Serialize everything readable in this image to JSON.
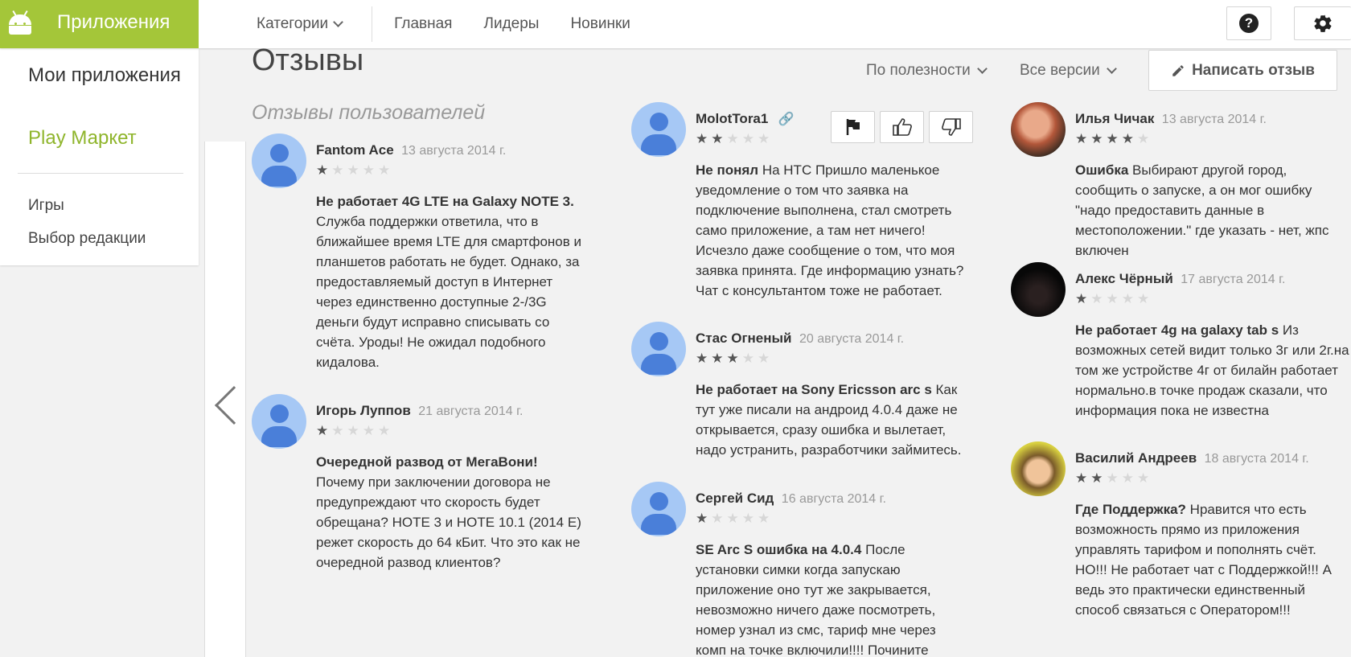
{
  "topbar": {
    "app_title": "Приложения",
    "nav": {
      "categories": "Категории",
      "home": "Главная",
      "leaders": "Лидеры",
      "new": "Новинки"
    },
    "help_icon": "question-circle-icon",
    "settings_icon": "gear-icon"
  },
  "sidebar": {
    "my_apps": "Мои приложения",
    "play_market": "Play Маркет",
    "games": "Игры",
    "editors_choice": "Выбор редакции"
  },
  "colors": {
    "brand": "#a4c639",
    "play_market": "#8fb52c",
    "avatar_placeholder": "#a6c8f5"
  },
  "reviews_section": {
    "title": "Отзывы",
    "subtitle": "Отзывы пользователей",
    "sort_filter": "По полезности",
    "version_filter": "Все версии",
    "write_review": "Написать отзыв"
  },
  "reviews": {
    "r1": {
      "author": "Fantom Ace",
      "date": "13 августа 2014 г.",
      "rating": 1,
      "headline": "Не работает 4G LTE на Galaxy NOTE 3.",
      "body": "Служба поддержки ответила, что в ближайшее время LTE для смартфонов и планшетов работать не будет. Однако, за предоставляемый доступ в Интернет через единственно доступные 2-/3G деньги будут исправно списывать со счёта. Уроды! Не ожидал подобного кидалова."
    },
    "r2": {
      "author": "Игорь Луппов",
      "date": "21 августа 2014 г.",
      "rating": 1,
      "headline": "Очередной развод от МегаВони!",
      "body": "Почему при заключении договора не предупреждают что скорость будет обрещана? НОТЕ 3 и НОТЕ 10.1 (2014 E) режет скорость до 64 кБит. Что это как не очередной развод клиентов?"
    },
    "r3": {
      "author": "MolotTora1",
      "date": "",
      "rating": 2,
      "headline": "Не понял",
      "body": "На НТС Пришло маленькое уведомление о том что заявка на подключение выполнена, стал смотреть само приложение, а там нет ничего! Исчезло даже сообщение о том, что моя заявка принята. Где информацию узнать? Чат с консультантом тоже не работает."
    },
    "r4": {
      "author": "Стас Огненый",
      "date": "20 августа 2014 г.",
      "rating": 3,
      "headline": "Не работает на Sony Ericsson arc s",
      "body": "Как тут уже писали на андроид 4.0.4 даже не открывается, сразу ошибка и вылетает, надо устранить, разработчики займитесь."
    },
    "r5": {
      "author": "Сергей Сид",
      "date": "16 августа 2014 г.",
      "rating": 1,
      "headline": "SE Arc S ошибка на 4.0.4",
      "body": "После установки симки когда запускаю приложение оно тут же закрывается, невозможно ничего даже посмотреть, номер узнал из смс, тариф мне через комп на точке включили!!!! Почините срочно, так дело не пойдет!!!!"
    },
    "r6": {
      "author": "Илья Чичак",
      "date": "13 августа 2014 г.",
      "rating": 4,
      "headline": "Ошибка",
      "body": "Выбирают другой город, сообщить о запуске, а он мог ошибку \"надо предоставить данные в местоположении.\" где указать - нет, жпс включен"
    },
    "r7": {
      "author": "Алекс Чёрный",
      "date": "17 августа 2014 г.",
      "rating": 1,
      "headline": "Не работает 4g на galaxy tab s",
      "body": "Из возможных сетей видит только 3г или 2г.на том же устройстве 4г от билайн работает нормально.в точке продаж сказали, что информация пока не известна"
    },
    "r8": {
      "author": "Василий Андреев",
      "date": "18 августа 2014 г.",
      "rating": 2,
      "headline": "Где Поддержка?",
      "body": "Нравится что есть возможность прямо из приложения управлять тарифом и пополнять счёт. НО!!! Не работает чат с Поддержкой!!! А ведь это практически единственный способ связаться с Оператором!!!"
    }
  }
}
